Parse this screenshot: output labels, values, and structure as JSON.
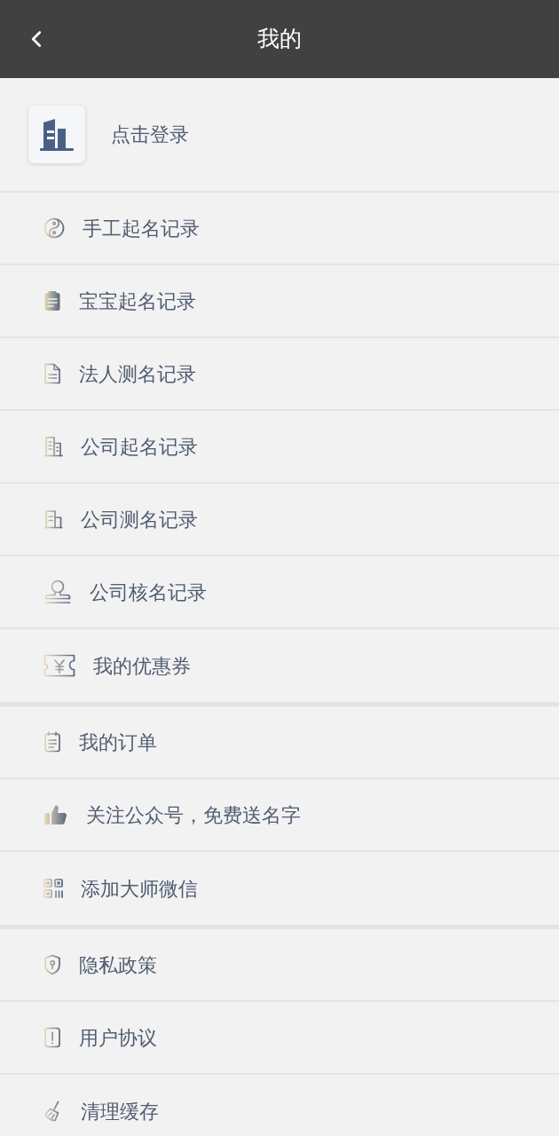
{
  "header": {
    "title": "我的"
  },
  "profile": {
    "login_label": "点击登录"
  },
  "menu_groups": [
    {
      "items": [
        {
          "label": "手工起名记录"
        },
        {
          "label": "宝宝起名记录"
        },
        {
          "label": "法人测名记录"
        },
        {
          "label": "公司起名记录"
        },
        {
          "label": "公司测名记录"
        },
        {
          "label": "公司核名记录"
        },
        {
          "label": "我的优惠券"
        }
      ]
    },
    {
      "items": [
        {
          "label": "我的订单"
        },
        {
          "label": "关注公众号，免费送名字"
        },
        {
          "label": "添加大师微信"
        }
      ]
    },
    {
      "items": [
        {
          "label": "隐私政策"
        },
        {
          "label": "用户协议"
        },
        {
          "label": "清理缓存"
        }
      ]
    }
  ]
}
